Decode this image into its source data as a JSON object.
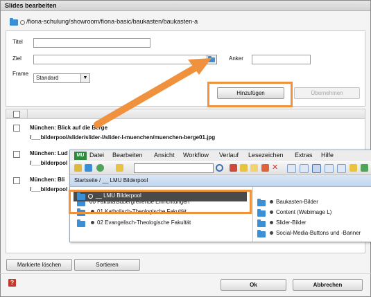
{
  "dialog": {
    "title": "Slides bearbeiten",
    "path": "/fiona-schulung/showroom/fiona-basic/baukasten/baukasten-a"
  },
  "form": {
    "titel_label": "Titel",
    "ziel_label": "Ziel",
    "anker_label": "Anker",
    "frame_label": "Frame",
    "frame_value": "Standard",
    "hinzufuegen_label": "Hinzufügen",
    "uebernehmen_label": "Übernehmen"
  },
  "list": {
    "items": [
      {
        "title": "München: Blick auf die Berge",
        "path": "/___bilderpool/slider/slider-l/slider-l-muenchen/muenchen-berge01.jpg"
      },
      {
        "title": "München: Lud",
        "path": "/___bilderpool"
      },
      {
        "title": "München: Bli",
        "path": "/___bilderpool"
      }
    ]
  },
  "popup": {
    "logo": "MU",
    "menu": [
      "Datei",
      "Bearbeiten",
      "Ansicht",
      "Workflow",
      "Verlauf",
      "Lesezeichen",
      "Extras",
      "Hilfe"
    ],
    "breadcrumb": "Startseite / __ LMU Bilderpool",
    "selected_item": "__ LMU Bilderpool",
    "left_items": [
      "00 Fakultätsübergreifende Einrichtungen",
      "01 Katholisch-Theologische Fakultät",
      "02 Evangelisch-Theologische Fakultät"
    ],
    "right_items": [
      "Baukasten-Bilder",
      "Content (Webimage L)",
      "Slider-Bilder",
      "Social-Media-Buttons und -Banner"
    ]
  },
  "footer": {
    "delete_label": "Markierte löschen",
    "sort_label": "Sortieren",
    "ok_label": "Ok",
    "cancel_label": "Abbrechen"
  },
  "colors": {
    "highlight": "#f0923d",
    "folder": "#3a8fd6",
    "selected_bg": "#4a4a4a"
  }
}
